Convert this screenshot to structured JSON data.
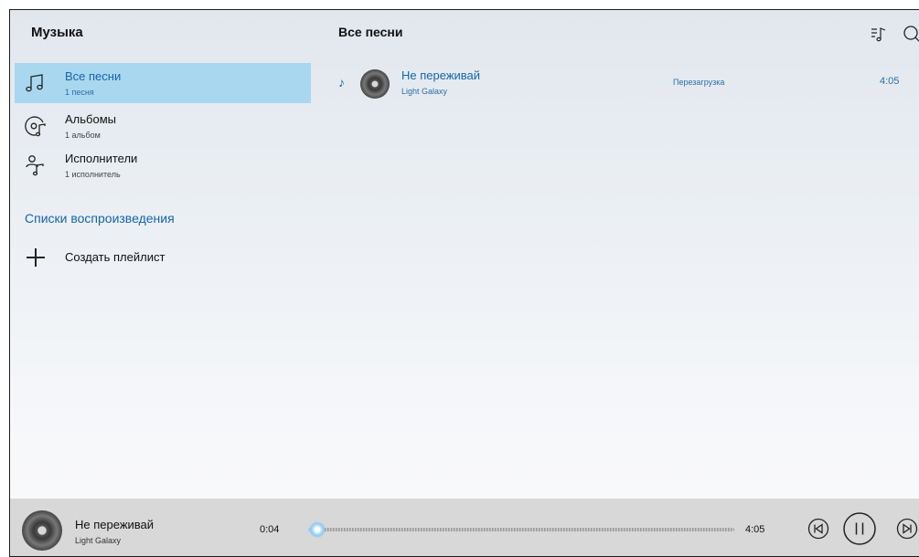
{
  "app": {
    "left_title": "Музыка",
    "right_title": "Все песни"
  },
  "nav": [
    {
      "label": "Все песни",
      "sub": "1 песня",
      "icon": "music-notes-icon",
      "active": true
    },
    {
      "label": "Альбомы",
      "sub": "1 альбом",
      "icon": "album-disc-icon",
      "active": false
    },
    {
      "label": "Исполнители",
      "sub": "1 исполнитель",
      "icon": "artist-icon",
      "active": false
    }
  ],
  "playlists": {
    "heading": "Списки воспроизведения",
    "create_label": "Создать плейлист",
    "create_icon": "plus-icon"
  },
  "toolbar": {
    "icons": [
      "queue-music-icon",
      "search-icon"
    ]
  },
  "songs": [
    {
      "title": "Не переживай",
      "artist": "Light Galaxy",
      "album": "Перезагрузка",
      "duration": "4:05",
      "playing_icon": "♪"
    }
  ],
  "player": {
    "title": "Не переживай",
    "artist": "Light Galaxy",
    "current_time": "0:04",
    "total_time": "4:05",
    "progress_fraction": 0.016,
    "icons": [
      "previous-icon",
      "pause-icon",
      "next-icon"
    ]
  },
  "colors": {
    "accent": "#1565a8",
    "selected_bg": "#a9d7f0",
    "player_bg": "#d8d8d8"
  }
}
